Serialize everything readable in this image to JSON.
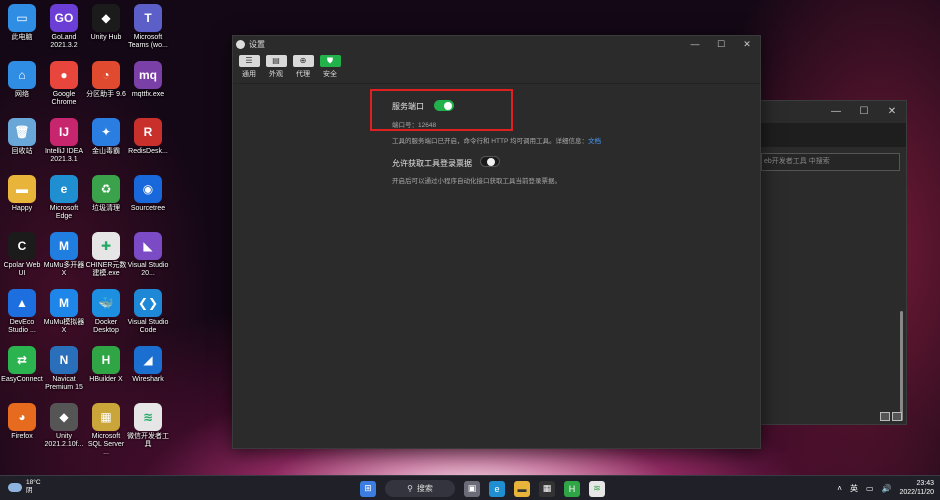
{
  "desktop": {
    "icons": [
      {
        "label": "此电脑",
        "icon": "computer-icon",
        "color": "#2f8de4",
        "glyph": "▭"
      },
      {
        "label": "GoLand 2021.3.2",
        "icon": "goland-icon",
        "color": "#6b3fd6",
        "glyph": "GO"
      },
      {
        "label": "Unity Hub",
        "icon": "unity-hub-icon",
        "color": "#1b1b1b",
        "glyph": "◆"
      },
      {
        "label": "Microsoft Teams (wo...",
        "icon": "teams-icon",
        "color": "#5b5fc7",
        "glyph": "T"
      },
      {
        "label": "网络",
        "icon": "network-icon",
        "color": "#2f8de4",
        "glyph": "⌂"
      },
      {
        "label": "Google Chrome",
        "icon": "chrome-icon",
        "color": "#e8453c",
        "glyph": "●"
      },
      {
        "label": "分区助手 9.6",
        "icon": "partition-assistant-icon",
        "color": "#e04a2f",
        "glyph": "◔"
      },
      {
        "label": "mqttfx.exe",
        "icon": "mqttfx-icon",
        "color": "#7b3fa8",
        "glyph": "mq"
      },
      {
        "label": "回收站",
        "icon": "recycle-bin-icon",
        "color": "#6aa7d9",
        "glyph": "🗑"
      },
      {
        "label": "IntelliJ IDEA 2021.3.1",
        "icon": "intellij-icon",
        "color": "#c7256d",
        "glyph": "IJ"
      },
      {
        "label": "金山毒霸",
        "icon": "kingsoft-antivirus-icon",
        "color": "#2a7de1",
        "glyph": "✦"
      },
      {
        "label": "RedisDesk...",
        "icon": "redis-desktop-icon",
        "color": "#c9302c",
        "glyph": "R"
      },
      {
        "label": "Happy",
        "icon": "folder-icon",
        "color": "#e8b43a",
        "glyph": "▬"
      },
      {
        "label": "Microsoft Edge",
        "icon": "edge-icon",
        "color": "#1f8fd1",
        "glyph": "e"
      },
      {
        "label": "垃圾清理",
        "icon": "cleanup-icon",
        "color": "#3aa24a",
        "glyph": "♻"
      },
      {
        "label": "Sourcetree",
        "icon": "sourcetree-icon",
        "color": "#1868db",
        "glyph": "◉"
      },
      {
        "label": "Cpolar Web UI",
        "icon": "cpolar-icon",
        "color": "#1b1b1b",
        "glyph": "C"
      },
      {
        "label": "MuMu多开器X",
        "icon": "mumu-multi-icon",
        "color": "#1f7ee0",
        "glyph": "M"
      },
      {
        "label": "CHINER元数建模.exe",
        "icon": "chiner-icon",
        "color": "#e6e6e6",
        "glyph": "✚"
      },
      {
        "label": "Visual Studio 20...",
        "icon": "visual-studio-icon",
        "color": "#7a4bc4",
        "glyph": "◣"
      },
      {
        "label": "DevEco Studio ...",
        "icon": "deveco-icon",
        "color": "#1d6fe0",
        "glyph": "▲"
      },
      {
        "label": "MuMu模拟器X",
        "icon": "mumu-emulator-icon",
        "color": "#1e86e8",
        "glyph": "M"
      },
      {
        "label": "Docker Desktop",
        "icon": "docker-icon",
        "color": "#1d8fe0",
        "glyph": "🐳"
      },
      {
        "label": "Visual Studio Code",
        "icon": "vscode-icon",
        "color": "#1e88d6",
        "glyph": "❮❯"
      },
      {
        "label": "EasyConnect",
        "icon": "easyconnect-icon",
        "color": "#2bb34f",
        "glyph": "⇄"
      },
      {
        "label": "Navicat Premium 15",
        "icon": "navicat-icon",
        "color": "#2a6fb9",
        "glyph": "N"
      },
      {
        "label": "HBuilder X",
        "icon": "hbuilder-icon",
        "color": "#2fa545",
        "glyph": "H"
      },
      {
        "label": "Wireshark",
        "icon": "wireshark-icon",
        "color": "#1a6fd0",
        "glyph": "◢"
      },
      {
        "label": "Firefox",
        "icon": "firefox-icon",
        "color": "#e66b1f",
        "glyph": "◕"
      },
      {
        "label": "Unity 2021.2.10f...",
        "icon": "unity-icon",
        "color": "#555555",
        "glyph": "◆"
      },
      {
        "label": "Microsoft SQL Server ...",
        "icon": "sql-server-icon",
        "color": "#c9a53a",
        "glyph": "▦"
      },
      {
        "label": "微信开发者工具",
        "icon": "wechat-devtools-icon",
        "color": "#e6e6e6",
        "glyph": "≋"
      }
    ]
  },
  "settings_window": {
    "title": "设置",
    "tabs": [
      {
        "label": "通用",
        "icon": "general-icon",
        "glyph": "☰",
        "active": false
      },
      {
        "label": "外观",
        "icon": "appearance-icon",
        "glyph": "▤",
        "active": false
      },
      {
        "label": "代理",
        "icon": "proxy-icon",
        "glyph": "⊕",
        "active": false
      },
      {
        "label": "安全",
        "icon": "security-icon",
        "glyph": "⛊",
        "active": true
      }
    ],
    "service_port": {
      "title": "服务端口",
      "port_label": "端口号：12648",
      "enabled": true,
      "description": "工具的服务端口已开启，命令行和 HTTP 均可调用工具。详细信息：",
      "doc_link": "文档"
    },
    "allow_login_ticket": {
      "title": "允许获取工具登录票据",
      "enabled": false,
      "description": "开启后可以通过小程序自动化接口获取工具当前登录票据。"
    },
    "window_controls": {
      "minimize": "—",
      "maximize": "☐",
      "close": "✕"
    }
  },
  "background_window": {
    "search_placeholder": "eb开发者工具 中搜索",
    "controls": {
      "minimize": "—",
      "maximize": "☐",
      "close": "✕"
    }
  },
  "taskbar": {
    "weather_temp": "18°C",
    "weather_cond": "阴",
    "search_label": "搜索",
    "ime": "英",
    "time": "23:43",
    "date": "2022/11/20"
  },
  "colors": {
    "accent_green": "#22b24c",
    "highlight_red": "#e02020",
    "link_blue": "#4a9eff"
  }
}
